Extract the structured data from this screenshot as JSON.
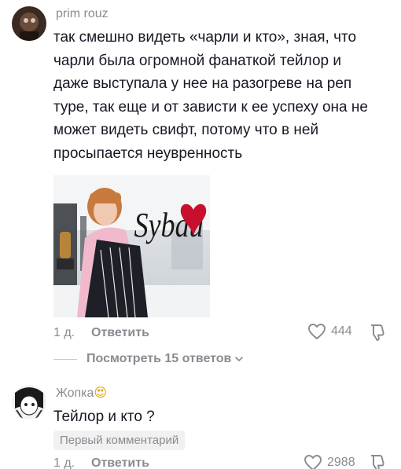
{
  "comments": [
    {
      "username": "prim rouz",
      "text_lines": [
        "так смешно видеть «чарли и кто», зная, что",
        "чарли была огромной фанаткой тейлор и",
        "даже выступала у нее на разогреве на реп",
        "туре, так еще и от зависти к ее успеху она не",
        "может видеть свифт, потому что в ней",
        "просыпается неувренность"
      ],
      "image_caption": "Sybau",
      "time": "1 д.",
      "reply_label": "Ответить",
      "likes": "444",
      "view_replies": "Посмотреть 15 ответов"
    },
    {
      "username": "Жопка",
      "username_emoji": "😍",
      "text": "Тейлор и кто ?",
      "badge": "Первый комментарий",
      "time": "1 д.",
      "reply_label": "Ответить",
      "likes": "2988"
    }
  ],
  "icons": {
    "like": "heart-outline-icon",
    "dislike": "thumbs-down-outline-icon",
    "chevron": "chevron-down-icon"
  }
}
